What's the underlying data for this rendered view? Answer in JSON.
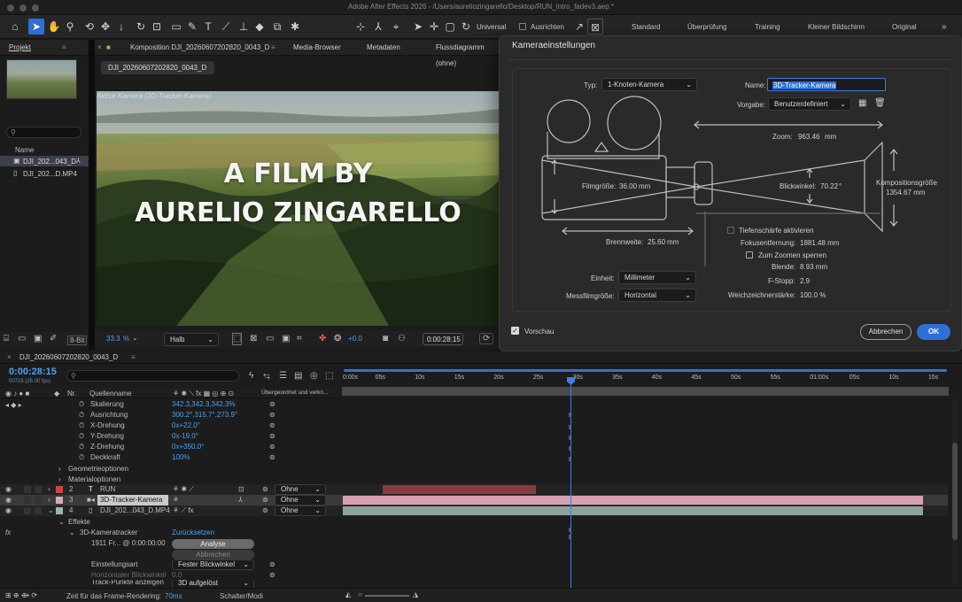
{
  "app": {
    "title": "Adobe After Effects 2026 - /Users/aureliozingarello/Desktop/RUN_Intro_fadev3.aep *"
  },
  "toolbar": {
    "universal_label": "Universal",
    "align_label": "Ausrichten",
    "workspaces": [
      "Standard",
      "Überprüfung",
      "Training",
      "Kleiner Bildschirm",
      "Original"
    ],
    "more": "»"
  },
  "project": {
    "tab": "Projekt",
    "search_placeholder": "",
    "col_name": "Name",
    "items": [
      "DJI_202...043_D",
      "DJI_202...D.MP4"
    ],
    "bitdepth": "8-Bit"
  },
  "comp_tabs": {
    "comp": "Komposition DJI_20260607202820_0043_D",
    "media": "Media-Browser",
    "meta": "Metadaten",
    "flow": "Flussdiagramm (ohne)"
  },
  "viewer": {
    "subtab": "DJI_20260607202820_0043_D",
    "active_camera": "Aktive Kamera (3D-Tracker-Kamera)",
    "title_line1": "A FILM BY",
    "title_line2": "AURELIO ZINGARELLO",
    "zoom": "33.3",
    "zoom_unit": "%",
    "quality": "Halb",
    "exposure": "+0.0",
    "timecode": "0:00:28:15"
  },
  "dialog": {
    "title": "Kameraeinstellungen",
    "typ_label": "Typ:",
    "typ_value": "1-Knoten-Kamera",
    "name_label": "Name:",
    "name_value": "3D-Tracker-Kamera",
    "vorgabe_label": "Vorgabe:",
    "vorgabe_value": "Benutzerdefiniert",
    "zoom_label": "Zoom:",
    "zoom_value": "963.46",
    "zoom_unit": "mm",
    "filmgroesse_label": "Filmgröße:",
    "filmgroesse_value": "36.00",
    "filmgroesse_unit": "mm",
    "blickwinkel_label": "Blickwinkel:",
    "blickwinkel_value": "70.22",
    "blickwinkel_unit": "°",
    "kompgroesse_label": "Kompositionsgröße",
    "kompgroesse_value": "1354.67 mm",
    "tiefenschaerfe_label": "Tiefenschärfe aktivieren",
    "fokus_label": "Fokusentfernung:",
    "fokus_value": "1881.48 mm",
    "zoomsperren_label": "Zum Zoomen sperren",
    "brennweite_label": "Brennweite:",
    "brennweite_value": "25.60",
    "brennweite_unit": "mm",
    "blende_label": "Blende:",
    "blende_value": "8.93 mm",
    "fstopp_label": "F-Stopp:",
    "fstopp_value": "2.9",
    "weich_label": "Weichzeichnerstärke:",
    "weich_value": "100.0 %",
    "einheit_label": "Einheit:",
    "einheit_value": "Millimeter",
    "messfilm_label": "Messfilmgröße:",
    "messfilm_value": "Horizontal",
    "vorschau_label": "Vorschau",
    "cancel": "Abbrechen",
    "ok": "OK"
  },
  "timeline": {
    "tab": "DJI_20260607202820_0043_D",
    "timecode": "0:00:28:15",
    "frames": "00715 (25.00 fps)",
    "col_nr": "Nr.",
    "col_source": "Quellenname",
    "col_parent": "Übergeordnet und verkn...",
    "ruler": [
      "0:00s",
      "05s",
      "10s",
      "15s",
      "20s",
      "25s",
      "30s",
      "35s",
      "40s",
      "45s",
      "50s",
      "55s",
      "01:00s",
      "05s",
      "10s",
      "15s"
    ],
    "props": [
      {
        "name": "Skalierung",
        "value": "342.3,342.3,342.3%"
      },
      {
        "name": "Ausrichtung",
        "value": "300.2°,315.7°,273.9°"
      },
      {
        "name": "X-Drehung",
        "value": "0x+22.0°"
      },
      {
        "name": "Y-Drehung",
        "value": "0x-19.0°"
      },
      {
        "name": "Z-Drehung",
        "value": "0x+350.0°"
      },
      {
        "name": "Deckkraft",
        "value": "100%"
      }
    ],
    "groups": [
      "Geometrieoptionen",
      "Materialoptionen"
    ],
    "layers": [
      {
        "num": "2",
        "name": "RUN",
        "parent": "Ohne"
      },
      {
        "num": "3",
        "name": "3D-Tracker-Kamera",
        "parent": "Ohne"
      },
      {
        "num": "4",
        "name": "DJI_202...043_D.MP4",
        "parent": "Ohne"
      }
    ],
    "effects_label": "Effekte",
    "tracker_label": "3D-Kameratracker",
    "reset_label": "Zurücksetzen",
    "frames_info": "1911 Fr... @ 0:00:00:00",
    "analyse": "Analyse",
    "abbrechen": "Abbrechen",
    "einstellungsart_label": "Einstellungsart",
    "einstellungsart_value": "Fester Blickwinkel",
    "horizontal_label": "Horizontaler Blickwinkel",
    "horizontal_value": "0.0",
    "trackpunkte_label": "Track-Punkte anzeigen",
    "trackpunkte_value": "3D aufgelöst",
    "render_label": "Zeit für das Frame-Rendering:",
    "render_value": "70ms",
    "switches_label": "Schalter/Modi"
  },
  "colors": {
    "accent": "#2f6fd6",
    "timecode": "#4aa3f0",
    "run_bar": "#8a3b3b",
    "camera_bar": "#d7a1b2",
    "footage_bar": "#8ea3a0"
  }
}
